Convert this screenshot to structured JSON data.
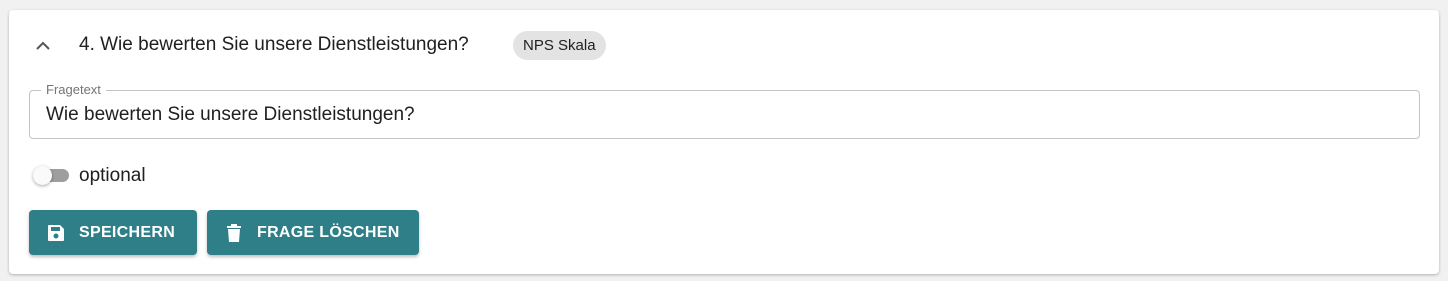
{
  "question": {
    "title": "4. Wie bewerten Sie unsere Dienstleistungen?",
    "type_chip": "NPS Skala",
    "collapse_icon": "chevron-up-icon"
  },
  "field": {
    "legend": "Fragetext",
    "value": "Wie bewerten Sie unsere Dienstleistungen?"
  },
  "optional_toggle": {
    "label": "optional",
    "checked": false
  },
  "actions": {
    "save_label": "SPEICHERN",
    "save_icon": "floppy-disk-icon",
    "delete_label": "FRAGE LÖSCHEN",
    "delete_icon": "trash-icon"
  },
  "colors": {
    "accent": "#2f7f89",
    "chip_bg": "#e3e3e3",
    "page_bg": "#f1f1f1"
  }
}
